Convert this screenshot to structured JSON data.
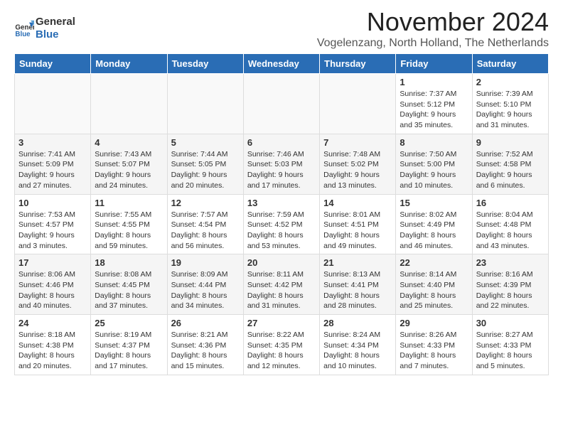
{
  "header": {
    "logo_line1": "General",
    "logo_line2": "Blue",
    "month_title": "November 2024",
    "subtitle": "Vogelenzang, North Holland, The Netherlands"
  },
  "days_of_week": [
    "Sunday",
    "Monday",
    "Tuesday",
    "Wednesday",
    "Thursday",
    "Friday",
    "Saturday"
  ],
  "weeks": [
    [
      {
        "day": "",
        "info": ""
      },
      {
        "day": "",
        "info": ""
      },
      {
        "day": "",
        "info": ""
      },
      {
        "day": "",
        "info": ""
      },
      {
        "day": "",
        "info": ""
      },
      {
        "day": "1",
        "info": "Sunrise: 7:37 AM\nSunset: 5:12 PM\nDaylight: 9 hours and 35 minutes."
      },
      {
        "day": "2",
        "info": "Sunrise: 7:39 AM\nSunset: 5:10 PM\nDaylight: 9 hours and 31 minutes."
      }
    ],
    [
      {
        "day": "3",
        "info": "Sunrise: 7:41 AM\nSunset: 5:09 PM\nDaylight: 9 hours and 27 minutes."
      },
      {
        "day": "4",
        "info": "Sunrise: 7:43 AM\nSunset: 5:07 PM\nDaylight: 9 hours and 24 minutes."
      },
      {
        "day": "5",
        "info": "Sunrise: 7:44 AM\nSunset: 5:05 PM\nDaylight: 9 hours and 20 minutes."
      },
      {
        "day": "6",
        "info": "Sunrise: 7:46 AM\nSunset: 5:03 PM\nDaylight: 9 hours and 17 minutes."
      },
      {
        "day": "7",
        "info": "Sunrise: 7:48 AM\nSunset: 5:02 PM\nDaylight: 9 hours and 13 minutes."
      },
      {
        "day": "8",
        "info": "Sunrise: 7:50 AM\nSunset: 5:00 PM\nDaylight: 9 hours and 10 minutes."
      },
      {
        "day": "9",
        "info": "Sunrise: 7:52 AM\nSunset: 4:58 PM\nDaylight: 9 hours and 6 minutes."
      }
    ],
    [
      {
        "day": "10",
        "info": "Sunrise: 7:53 AM\nSunset: 4:57 PM\nDaylight: 9 hours and 3 minutes."
      },
      {
        "day": "11",
        "info": "Sunrise: 7:55 AM\nSunset: 4:55 PM\nDaylight: 8 hours and 59 minutes."
      },
      {
        "day": "12",
        "info": "Sunrise: 7:57 AM\nSunset: 4:54 PM\nDaylight: 8 hours and 56 minutes."
      },
      {
        "day": "13",
        "info": "Sunrise: 7:59 AM\nSunset: 4:52 PM\nDaylight: 8 hours and 53 minutes."
      },
      {
        "day": "14",
        "info": "Sunrise: 8:01 AM\nSunset: 4:51 PM\nDaylight: 8 hours and 49 minutes."
      },
      {
        "day": "15",
        "info": "Sunrise: 8:02 AM\nSunset: 4:49 PM\nDaylight: 8 hours and 46 minutes."
      },
      {
        "day": "16",
        "info": "Sunrise: 8:04 AM\nSunset: 4:48 PM\nDaylight: 8 hours and 43 minutes."
      }
    ],
    [
      {
        "day": "17",
        "info": "Sunrise: 8:06 AM\nSunset: 4:46 PM\nDaylight: 8 hours and 40 minutes."
      },
      {
        "day": "18",
        "info": "Sunrise: 8:08 AM\nSunset: 4:45 PM\nDaylight: 8 hours and 37 minutes."
      },
      {
        "day": "19",
        "info": "Sunrise: 8:09 AM\nSunset: 4:44 PM\nDaylight: 8 hours and 34 minutes."
      },
      {
        "day": "20",
        "info": "Sunrise: 8:11 AM\nSunset: 4:42 PM\nDaylight: 8 hours and 31 minutes."
      },
      {
        "day": "21",
        "info": "Sunrise: 8:13 AM\nSunset: 4:41 PM\nDaylight: 8 hours and 28 minutes."
      },
      {
        "day": "22",
        "info": "Sunrise: 8:14 AM\nSunset: 4:40 PM\nDaylight: 8 hours and 25 minutes."
      },
      {
        "day": "23",
        "info": "Sunrise: 8:16 AM\nSunset: 4:39 PM\nDaylight: 8 hours and 22 minutes."
      }
    ],
    [
      {
        "day": "24",
        "info": "Sunrise: 8:18 AM\nSunset: 4:38 PM\nDaylight: 8 hours and 20 minutes."
      },
      {
        "day": "25",
        "info": "Sunrise: 8:19 AM\nSunset: 4:37 PM\nDaylight: 8 hours and 17 minutes."
      },
      {
        "day": "26",
        "info": "Sunrise: 8:21 AM\nSunset: 4:36 PM\nDaylight: 8 hours and 15 minutes."
      },
      {
        "day": "27",
        "info": "Sunrise: 8:22 AM\nSunset: 4:35 PM\nDaylight: 8 hours and 12 minutes."
      },
      {
        "day": "28",
        "info": "Sunrise: 8:24 AM\nSunset: 4:34 PM\nDaylight: 8 hours and 10 minutes."
      },
      {
        "day": "29",
        "info": "Sunrise: 8:26 AM\nSunset: 4:33 PM\nDaylight: 8 hours and 7 minutes."
      },
      {
        "day": "30",
        "info": "Sunrise: 8:27 AM\nSunset: 4:33 PM\nDaylight: 8 hours and 5 minutes."
      }
    ]
  ]
}
